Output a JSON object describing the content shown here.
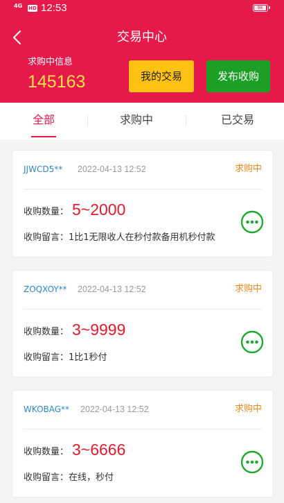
{
  "status_bar": {
    "signal": "4G",
    "hd": "HD",
    "time": "12:53",
    "battery": "96"
  },
  "header": {
    "title": "交易中心",
    "info_label": "求购中信息",
    "info_count": "145163",
    "my_trades_label": "我的交易",
    "publish_label": "发布收购"
  },
  "tabs": [
    {
      "label": "全部",
      "active": true
    },
    {
      "label": "求购中",
      "active": false
    },
    {
      "label": "已交易",
      "active": false
    }
  ],
  "cards": [
    {
      "user": "JJWCD5**",
      "time": "2022-04-13 12:52",
      "status": "求购中",
      "qty_label": "收购数量：",
      "qty_value": "5~2000",
      "message": "收购留言：1比1无限收人在秒付款备用机秒付款"
    },
    {
      "user": "ZOQXOY**",
      "time": "2022-04-13 12:52",
      "status": "求购中",
      "qty_label": "收购数量：",
      "qty_value": "3~9999",
      "message": "收购留言：1比1秒付"
    },
    {
      "user": "WKOBAG**",
      "time": "2022-04-13 12:52",
      "status": "求购中",
      "qty_label": "收购数量：",
      "qty_value": "3~6666",
      "message": "收购留言：在线，秒付"
    }
  ],
  "colors": {
    "primary": "#e5194a",
    "accent_yellow": "#fdc214",
    "accent_green": "#1ba025",
    "status_orange": "#ec8a1e"
  }
}
